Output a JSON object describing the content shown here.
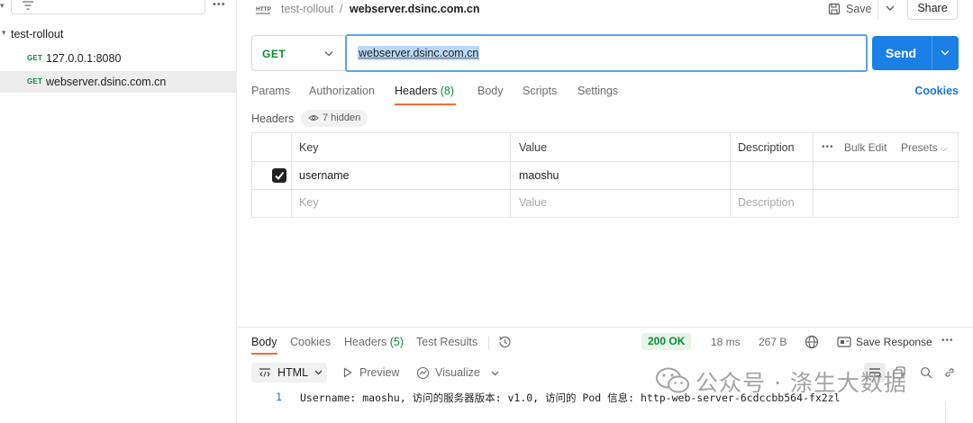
{
  "sidebar": {
    "collection_name": "test-rollout",
    "requests": [
      {
        "method": "GET",
        "url": "127.0.0.1:8080"
      },
      {
        "method": "GET",
        "url": "webserver.dsinc.com.cn"
      }
    ]
  },
  "header": {
    "breadcrumb_parent": "test-rollout",
    "breadcrumb_separator": "/",
    "breadcrumb_current": "webserver.dsinc.com.cn",
    "save_label": "Save",
    "share_label": "Share"
  },
  "request": {
    "method": "GET",
    "url": "webserver.dsinc.com.cn",
    "send_label": "Send"
  },
  "tabs": {
    "params": "Params",
    "authorization": "Authorization",
    "headers": "Headers",
    "headers_count": "(8)",
    "body": "Body",
    "scripts": "Scripts",
    "settings": "Settings",
    "cookies": "Cookies"
  },
  "headers_section": {
    "label": "Headers",
    "hidden_label": "7 hidden",
    "columns": {
      "key": "Key",
      "value": "Value",
      "description": "Description"
    },
    "bulk_edit": "Bulk Edit",
    "presets": "Presets",
    "rows": [
      {
        "checked": true,
        "key": "username",
        "value": "maoshu",
        "description": ""
      }
    ],
    "placeholder": {
      "key": "Key",
      "value": "Value",
      "description": "Description"
    }
  },
  "response": {
    "tabs": {
      "body": "Body",
      "cookies": "Cookies",
      "headers": "Headers",
      "headers_count": "(5)",
      "test_results": "Test Results"
    },
    "status": "200 OK",
    "time": "18 ms",
    "size": "267 B",
    "save_response": "Save Response",
    "format": "HTML",
    "preview": "Preview",
    "visualize": "Visualize",
    "line_number": "1",
    "body_text": "Username: maoshu, 访问的服务器版本: v1.0, 访问的 Pod 信息: http-web-server-6cdccbb564-fx2zl"
  },
  "watermark": {
    "text": "公众号 · 涤生大数据"
  },
  "colors": {
    "accent_blue": "#1a7fe6",
    "method_green": "#0b8a3a",
    "tab_orange": "#f26b3a",
    "link_blue": "#1a73e8"
  },
  "icons": [
    "filter-icon",
    "more-icon",
    "http-icon",
    "save-icon",
    "chevron-down-icon",
    "eye-icon",
    "checkbox-checked-icon",
    "history-icon",
    "globe-icon",
    "save-response-icon",
    "code-icon",
    "play-icon",
    "visualize-icon",
    "wrap-icon",
    "copy-icon",
    "search-icon",
    "link-icon",
    "wechat-icon"
  ]
}
